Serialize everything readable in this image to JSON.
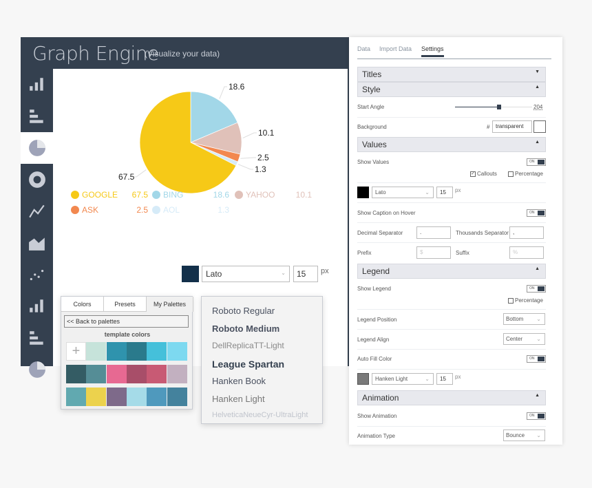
{
  "app": {
    "title": "Graph Engine",
    "subtitle": "(Visualize your data)"
  },
  "sidebar": {
    "items": [
      {
        "icon": "bar-chart-icon"
      },
      {
        "icon": "horizontal-bar-icon"
      },
      {
        "icon": "pie-chart-icon",
        "selected": true
      },
      {
        "icon": "donut-chart-icon"
      },
      {
        "icon": "line-chart-icon"
      },
      {
        "icon": "area-chart-icon"
      },
      {
        "icon": "scatter-chart-icon"
      },
      {
        "icon": "bar-chart-icon"
      },
      {
        "icon": "horizontal-bar-icon"
      },
      {
        "icon": "pie-chart-icon"
      }
    ]
  },
  "chart_data": {
    "type": "pie",
    "start_angle": 204,
    "categories": [
      "GOOGLE",
      "BING",
      "YAHOO",
      "ASK",
      "AOL"
    ],
    "values": [
      67.5,
      18.6,
      10.1,
      2.5,
      1.3
    ],
    "colors": [
      "#f6c917",
      "#a2d7e8",
      "#e0c1b9",
      "#f2884f",
      "#d6ebf8"
    ],
    "labels": [
      "67.5",
      "18.6",
      "10.1",
      "2.5",
      "1.3"
    ],
    "legend": "bottom"
  },
  "font_toolbar": {
    "color": "#13304a",
    "font": "Lato",
    "size": "15",
    "unit": "px"
  },
  "palette": {
    "tabs": [
      "Colors",
      "Presets",
      "My Palettes"
    ],
    "back": "<< Back to palettes",
    "heading": "template colors",
    "add": "+",
    "rows": [
      [
        "#c6e3da",
        "#2f93ad",
        "#2a7a8c",
        "#45c0da",
        "#7dd9f0"
      ],
      [
        "#345c64",
        "#558d96",
        "#e76992",
        "#a84e69",
        "#c85a74",
        "#c2b0c0"
      ],
      [
        "#61a9b0",
        "#ecd24d",
        "#7e6a8a",
        "#a5dbe8",
        "#4f99bd",
        "#44829d"
      ]
    ]
  },
  "font_list": [
    "Roboto Regular",
    "Roboto Medium",
    "DellReplicaTT-Light",
    "League Spartan",
    "Hanken Book",
    "Hanken Light",
    "HelveticaNeueCyr-UltraLight"
  ],
  "panel": {
    "tabs": [
      "Data",
      "Import Data",
      "Settings"
    ],
    "titles": "Titles",
    "style": "Style",
    "start_angle_label": "Start Angle",
    "start_angle": "204",
    "start_angle_fraction": 0.57,
    "background_label": "Background",
    "hash": "#",
    "background": "transparent",
    "values": "Values",
    "show_values": "Show Values",
    "on": "ON",
    "callouts": "Callouts",
    "percentage": "Percentage",
    "value_font": "Lato",
    "value_size": "15",
    "px": "px",
    "value_color": "#000000",
    "caption_hover": "Show Caption on Hover",
    "decimal_label": "Decimal Separator",
    "decimal": ".",
    "thousands_label": "Thousands Separator",
    "thousands": ",",
    "prefix_label": "Prefix",
    "prefix_ph": "$",
    "suffix_label": "Suffix",
    "suffix_ph": "%",
    "legend": "Legend",
    "show_legend": "Show Legend",
    "legend_pos_label": "Legend Position",
    "legend_pos": "Bottom",
    "legend_align_label": "Legend Align",
    "legend_align": "Center",
    "auto_fill": "Auto Fill Color",
    "legend_font": "Hanken Light",
    "legend_size": "15",
    "legend_color": "#7a7a7a",
    "animation": "Animation",
    "show_animation": "Show Animation",
    "anim_type_label": "Animation Type",
    "anim_type": "Bounce"
  }
}
